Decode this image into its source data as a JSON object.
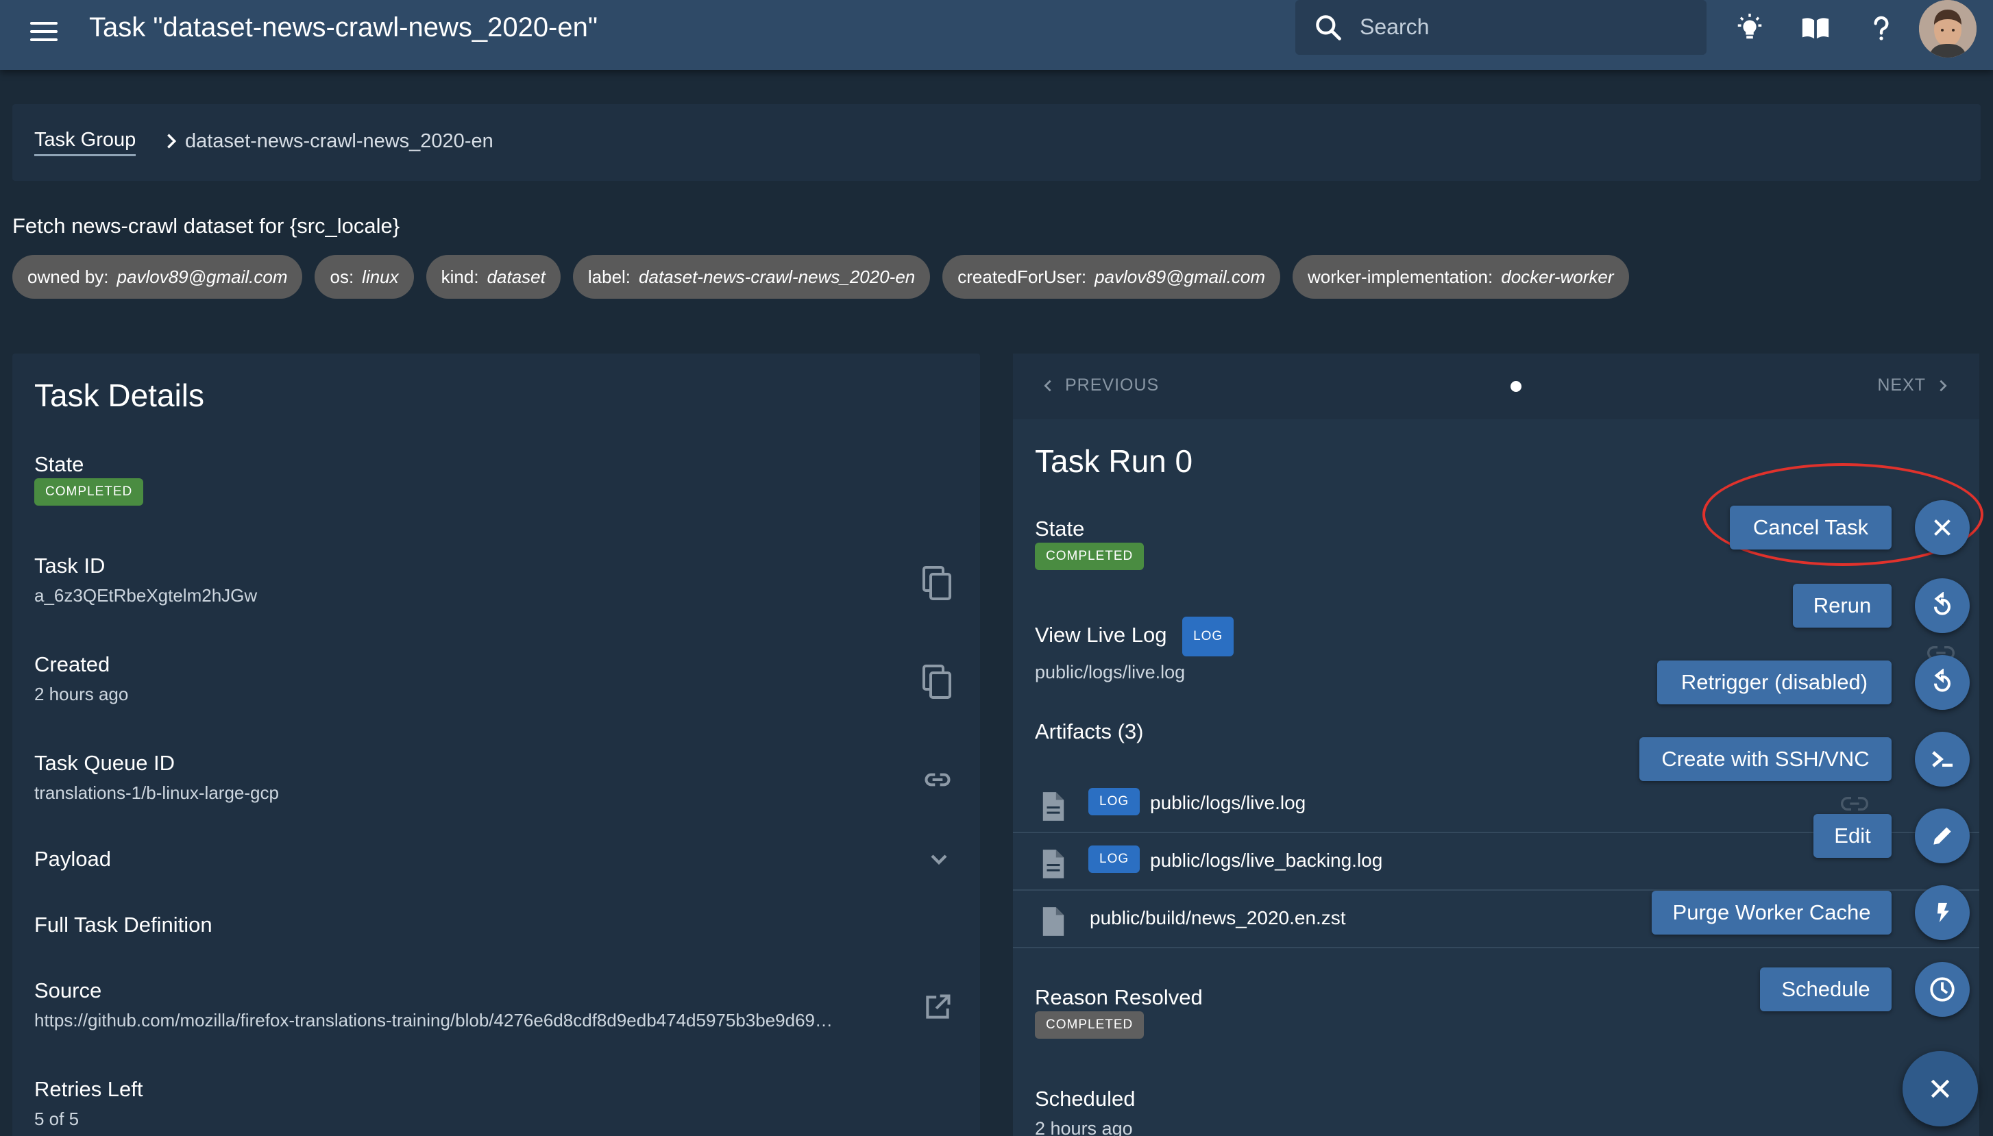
{
  "header": {
    "title": "Task \"dataset-news-crawl-news_2020-en\"",
    "search_placeholder": "Search"
  },
  "breadcrumb": {
    "root": "Task Group",
    "current": "dataset-news-crawl-news_2020-en"
  },
  "task_description": "Fetch news-crawl dataset for {src_locale}",
  "tags": [
    {
      "key": "owned by:",
      "value": "pavlov89@gmail.com"
    },
    {
      "key": "os:",
      "value": "linux"
    },
    {
      "key": "kind:",
      "value": "dataset"
    },
    {
      "key": "label:",
      "value": "dataset-news-crawl-news_2020-en"
    },
    {
      "key": "createdForUser:",
      "value": "pavlov89@gmail.com"
    },
    {
      "key": "worker-implementation:",
      "value": "docker-worker"
    }
  ],
  "task_details": {
    "title": "Task Details",
    "state_label": "State",
    "state_value": "COMPLETED",
    "task_id_label": "Task ID",
    "task_id_value": "a_6z3QEtRbeXgtelm2hJGw",
    "created_label": "Created",
    "created_value": "2 hours ago",
    "queue_label": "Task Queue ID",
    "queue_value": "translations-1/b-linux-large-gcp",
    "payload_label": "Payload",
    "full_def_label": "Full Task Definition",
    "source_label": "Source",
    "source_value": "https://github.com/mozilla/firefox-translations-training/blob/4276e6d8cdf8d9edb474d5975b3be9d69…",
    "retries_label": "Retries Left",
    "retries_value": "5 of 5"
  },
  "task_run": {
    "prev_label": "PREVIOUS",
    "next_label": "NEXT",
    "title": "Task Run 0",
    "state_label": "State",
    "state_value": "COMPLETED",
    "live_log_label": "View Live Log",
    "live_log_badge": "LOG",
    "live_log_path": "public/logs/live.log",
    "artifacts_label": "Artifacts (3)",
    "artifacts": [
      {
        "badge": "LOG",
        "name": "public/logs/live.log"
      },
      {
        "badge": "LOG",
        "name": "public/logs/live_backing.log"
      },
      {
        "badge": "",
        "name": "public/build/news_2020.en.zst"
      }
    ],
    "reason_label": "Reason Resolved",
    "reason_value": "COMPLETED",
    "scheduled_label": "Scheduled",
    "scheduled_value": "2 hours ago"
  },
  "actions": {
    "cancel": "Cancel Task",
    "rerun": "Rerun",
    "retrigger": "Retrigger (disabled)",
    "ssh": "Create with SSH/VNC",
    "edit": "Edit",
    "purge": "Purge Worker Cache",
    "schedule": "Schedule"
  },
  "colors": {
    "appbar": "#2f4a67",
    "background": "#1b2a38",
    "card": "#1f3042",
    "action": "#3d6ea6",
    "completed_badge": "#4a8c41",
    "annotation": "#e0322c"
  }
}
